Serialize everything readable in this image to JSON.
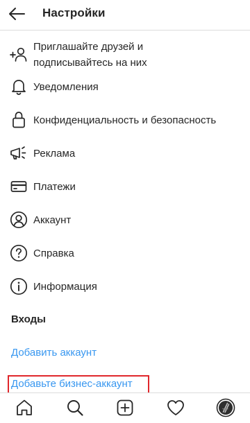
{
  "header": {
    "title": "Настройки",
    "back_icon": "arrow-left-icon"
  },
  "menu": [
    {
      "label_line1": "Приглашайте друзей и",
      "label_line2": "подписывайтесь на них",
      "icon": "add-person-icon"
    },
    {
      "label": "Уведомления",
      "icon": "bell-icon"
    },
    {
      "label": "Конфиденциальность и безопасность",
      "icon": "lock-icon"
    },
    {
      "label": "Реклама",
      "icon": "megaphone-icon"
    },
    {
      "label": "Платежи",
      "icon": "credit-card-icon"
    },
    {
      "label": "Аккаунт",
      "icon": "user-circle-icon"
    },
    {
      "label": "Справка",
      "icon": "help-circle-icon"
    },
    {
      "label": "Информация",
      "icon": "info-circle-icon"
    }
  ],
  "logins": {
    "section_title": "Входы",
    "add_account": "Добавить аккаунт",
    "add_business": "Добавьте бизнес-аккаунт"
  },
  "tabbar": [
    "home-icon",
    "search-icon",
    "new-post-icon",
    "heart-icon",
    "profile-avatar-icon"
  ],
  "colors": {
    "text": "#262626",
    "link": "#3897f0",
    "divider": "#dbdbdb",
    "highlight": "#e0262b"
  }
}
